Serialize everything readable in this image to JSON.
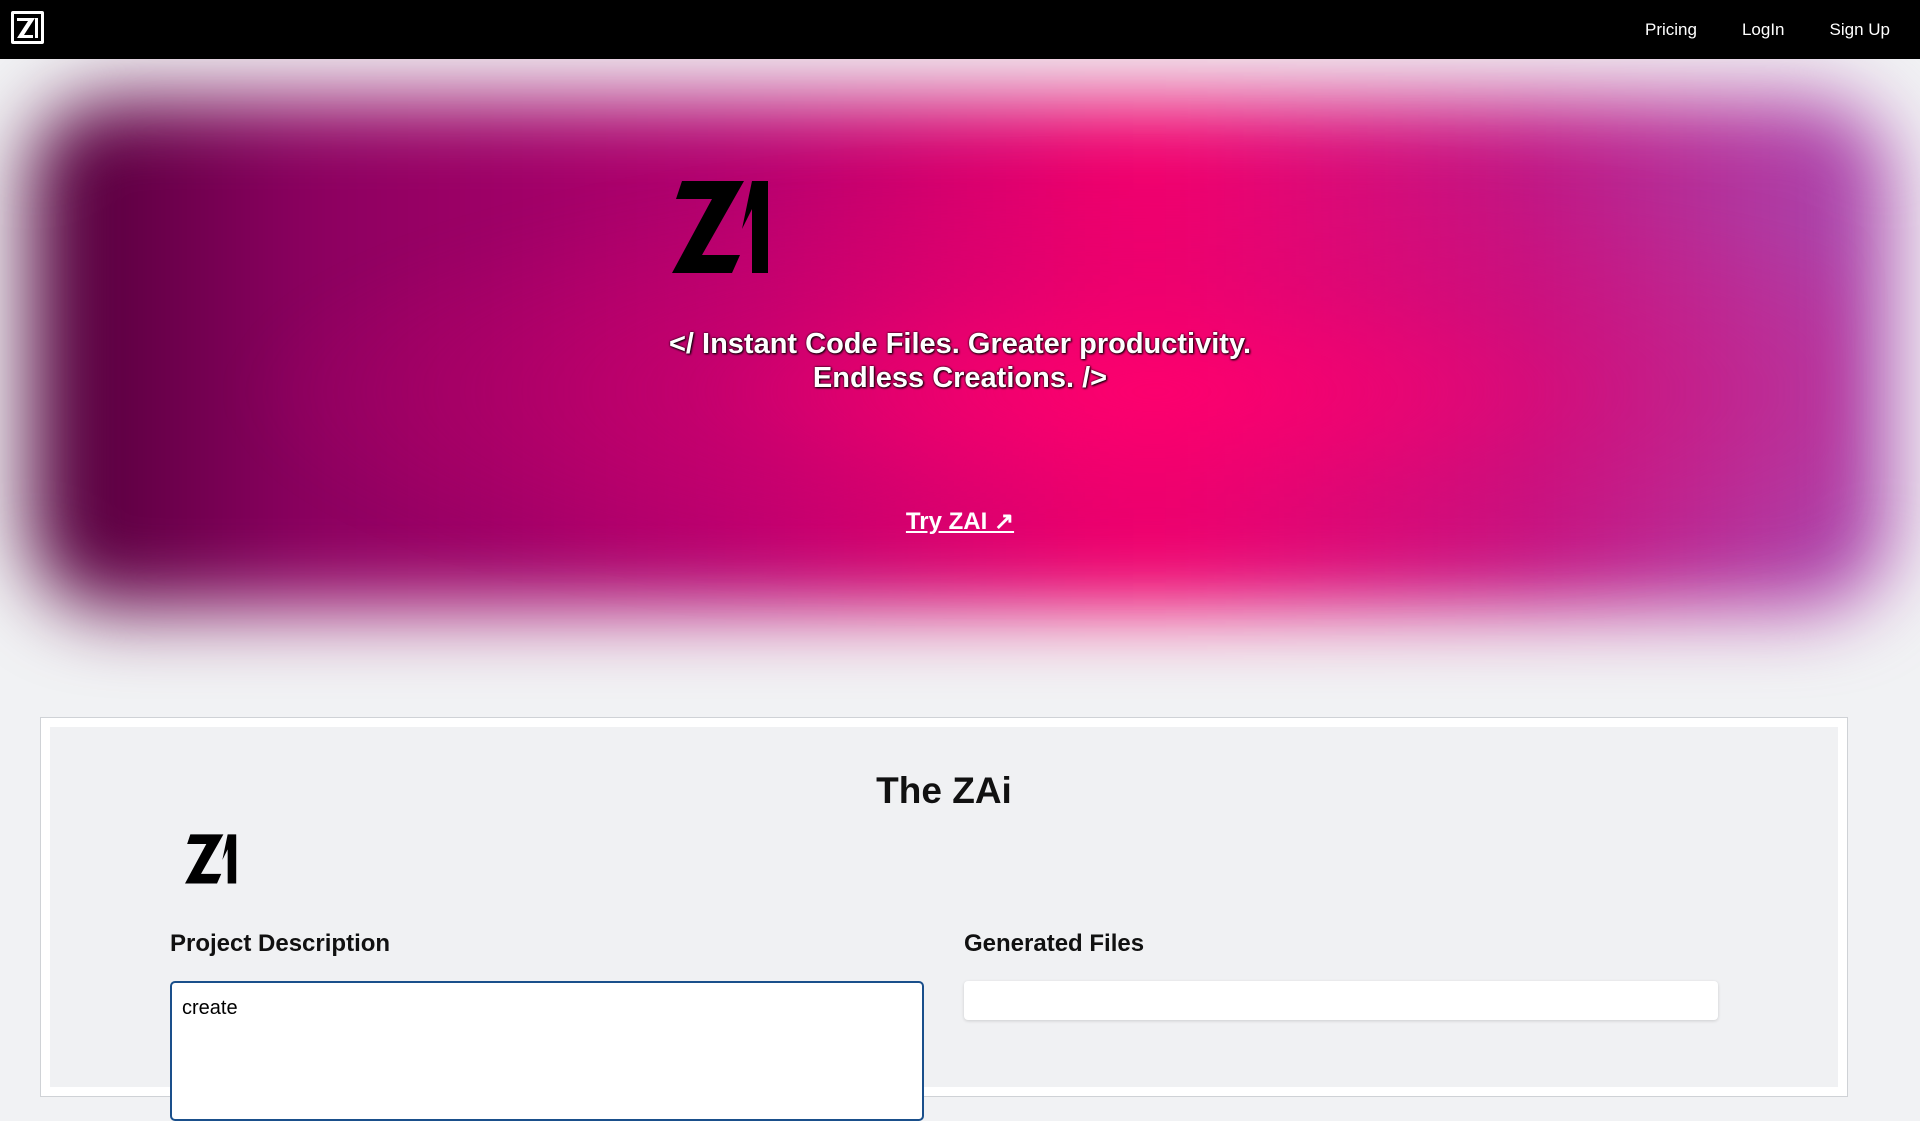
{
  "nav": {
    "logo_icon": "zi-logo-icon",
    "items": [
      {
        "label": "Pricing"
      },
      {
        "label": "LogIn"
      },
      {
        "label": "Sign Up"
      }
    ]
  },
  "hero": {
    "tagline_line1": "</ Instant Code Files. Greater productivity.",
    "tagline_line2": "Endless Creations. />",
    "cta_label": "Try ZAI ↗",
    "colors": {
      "dark": "#4d0038",
      "mid": "#b5006f",
      "hot": "#f4006d",
      "violet": "#a84bb0"
    }
  },
  "app": {
    "title": "The ZAi",
    "project_description_label": "Project Description",
    "project_description_value": "create ",
    "generated_files_label": "Generated Files",
    "accent": "#1a4f8b"
  }
}
